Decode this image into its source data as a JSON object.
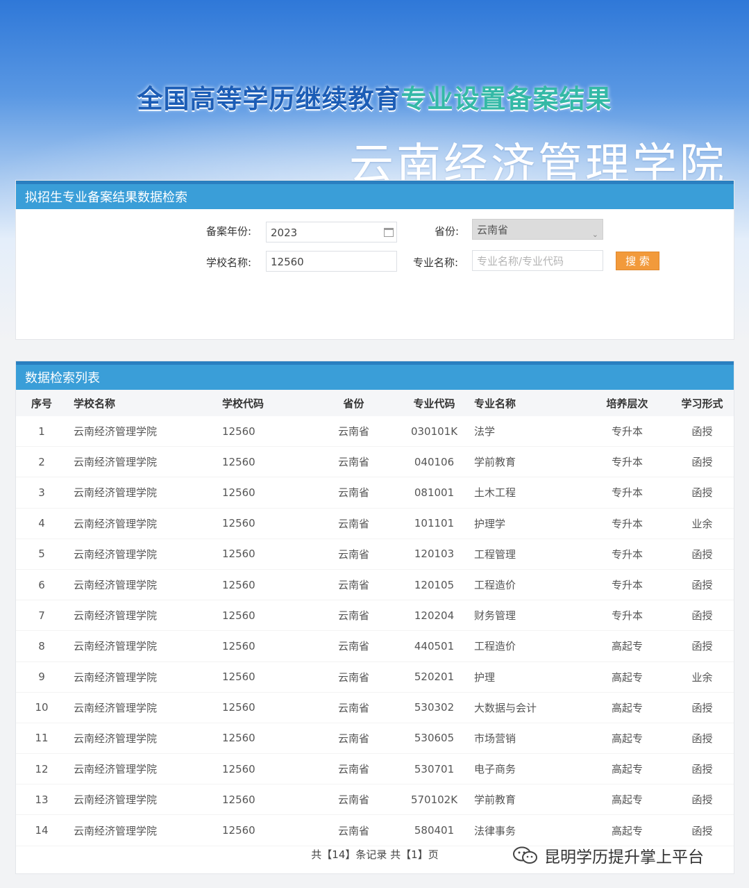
{
  "banner": {
    "title_part1": "全国高等学历继续教育",
    "title_part2": "专业设置备案结果",
    "school": "云南经济管理学院"
  },
  "search": {
    "header": "拟招生专业备案结果数据检索",
    "year_label": "备案年份:",
    "year_value": "2023",
    "province_label": "省份:",
    "province_value": "云南省",
    "school_label": "学校名称:",
    "school_value": "12560",
    "major_label": "专业名称:",
    "major_placeholder": "专业名称/专业代码",
    "search_button": "搜 索"
  },
  "list": {
    "header": "数据检索列表",
    "columns": [
      "序号",
      "学校名称",
      "学校代码",
      "省份",
      "专业代码",
      "专业名称",
      "培养层次",
      "学习形式"
    ],
    "rows": [
      [
        "1",
        "云南经济管理学院",
        "12560",
        "云南省",
        "030101K",
        "法学",
        "专升本",
        "函授"
      ],
      [
        "2",
        "云南经济管理学院",
        "12560",
        "云南省",
        "040106",
        "学前教育",
        "专升本",
        "函授"
      ],
      [
        "3",
        "云南经济管理学院",
        "12560",
        "云南省",
        "081001",
        "土木工程",
        "专升本",
        "函授"
      ],
      [
        "4",
        "云南经济管理学院",
        "12560",
        "云南省",
        "101101",
        "护理学",
        "专升本",
        "业余"
      ],
      [
        "5",
        "云南经济管理学院",
        "12560",
        "云南省",
        "120103",
        "工程管理",
        "专升本",
        "函授"
      ],
      [
        "6",
        "云南经济管理学院",
        "12560",
        "云南省",
        "120105",
        "工程造价",
        "专升本",
        "函授"
      ],
      [
        "7",
        "云南经济管理学院",
        "12560",
        "云南省",
        "120204",
        "财务管理",
        "专升本",
        "函授"
      ],
      [
        "8",
        "云南经济管理学院",
        "12560",
        "云南省",
        "440501",
        "工程造价",
        "高起专",
        "函授"
      ],
      [
        "9",
        "云南经济管理学院",
        "12560",
        "云南省",
        "520201",
        "护理",
        "高起专",
        "业余"
      ],
      [
        "10",
        "云南经济管理学院",
        "12560",
        "云南省",
        "530302",
        "大数据与会计",
        "高起专",
        "函授"
      ],
      [
        "11",
        "云南经济管理学院",
        "12560",
        "云南省",
        "530605",
        "市场营销",
        "高起专",
        "函授"
      ],
      [
        "12",
        "云南经济管理学院",
        "12560",
        "云南省",
        "530701",
        "电子商务",
        "高起专",
        "函授"
      ],
      [
        "13",
        "云南经济管理学院",
        "12560",
        "云南省",
        "570102K",
        "学前教育",
        "高起专",
        "函授"
      ],
      [
        "14",
        "云南经济管理学院",
        "12560",
        "云南省",
        "580401",
        "法律事务",
        "高起专",
        "函授"
      ]
    ],
    "pager": "共【14】条记录 共【1】页"
  },
  "watermark": {
    "text": "昆明学历提升掌上平台",
    "icon": "wechat-icon"
  }
}
